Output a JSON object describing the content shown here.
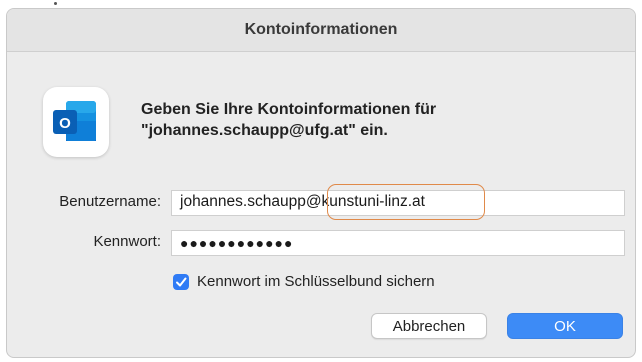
{
  "dialog": {
    "title": "Kontoinformationen",
    "prompt_line1": "Geben Sie Ihre Kontoinformationen für",
    "prompt_line2": "\"johannes.schaupp@ufg.at\" ein."
  },
  "form": {
    "username_label": "Benutzername:",
    "username_value": "johannes.schaupp@kunstuni-linz.at",
    "password_label": "Kennwort:",
    "password_value": "●●●●●●●●●●●●",
    "keychain_label": "Kennwort im Schlüsselbund sichern",
    "keychain_checked": true
  },
  "buttons": {
    "cancel_label": "Abbrechen",
    "ok_label": "OK"
  },
  "icons": {
    "app": "outlook-icon",
    "check": "checkmark-icon"
  },
  "colors": {
    "accent": "#3d8bf6",
    "highlight": "#e08a4a",
    "outlook_blue": "#0a64c8"
  }
}
